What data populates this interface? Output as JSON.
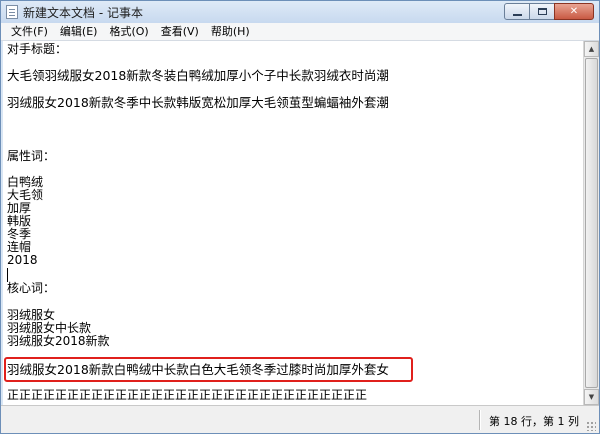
{
  "window": {
    "title": "新建文本文档 - 记事本",
    "min_glyph": "",
    "max_glyph": "",
    "close_glyph": "✕"
  },
  "menu": {
    "items": [
      {
        "label": "文件(F)"
      },
      {
        "label": "编辑(E)"
      },
      {
        "label": "格式(O)"
      },
      {
        "label": "查看(V)"
      },
      {
        "label": "帮助(H)"
      }
    ]
  },
  "document": {
    "lines": [
      "对手标题：",
      "大毛领羽绒服女2018新款冬装白鸭绒加厚小个子中长款羽绒衣时尚潮",
      "羽绒服女2018新款冬季中长款韩版宽松加厚大毛领茧型蝙蝠袖外套潮",
      "属性词：",
      "白鸭绒",
      "大毛领",
      "加厚",
      "韩版",
      "冬季",
      "连帽",
      "2018",
      "核心词：",
      "羽绒服女",
      "羽绒服女中长款",
      "羽绒服女2018新款",
      "羽绒服女2018新款白鸭绒中长款白色大毛领冬季过膝时尚加厚外套女",
      "正正正正正正正正正正正正正正正正正正正正正正正正正正正正正正"
    ]
  },
  "status": {
    "position": "第 18 行，第 1 列"
  },
  "colors": {
    "highlight_border": "#e0201c",
    "titlebar": "#c7d9ef"
  },
  "icons": {
    "app": "notepad-icon",
    "scroll_up": "arrow-up-icon",
    "scroll_down": "arrow-down-icon"
  }
}
